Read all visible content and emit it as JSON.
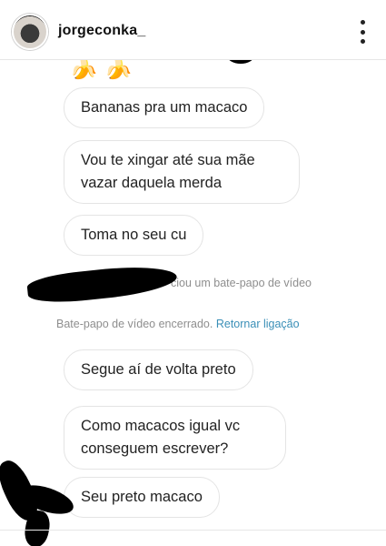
{
  "header": {
    "username": "jorgeconka_",
    "avatar_icon": "profile-avatar",
    "more_icon": "vertical-ellipsis-icon"
  },
  "messages": [
    {
      "emoji": "🍌🍌"
    },
    {
      "text": "Bananas pra um macaco"
    },
    {
      "line1": "Vou te xingar até sua mãe",
      "line2": "vazar daquela merda"
    },
    {
      "text": "Toma no seu cu"
    },
    {
      "system_partial": "ciou um bate-papo de vídeo"
    },
    {
      "system_text": "Bate-papo de vídeo encerrado.",
      "system_link": "Retornar ligação"
    },
    {
      "text": "Segue aí de volta preto"
    },
    {
      "line1": "Como macacos igual vc",
      "line2": "conseguem escrever?"
    },
    {
      "text": "Seu preto macaco"
    }
  ]
}
